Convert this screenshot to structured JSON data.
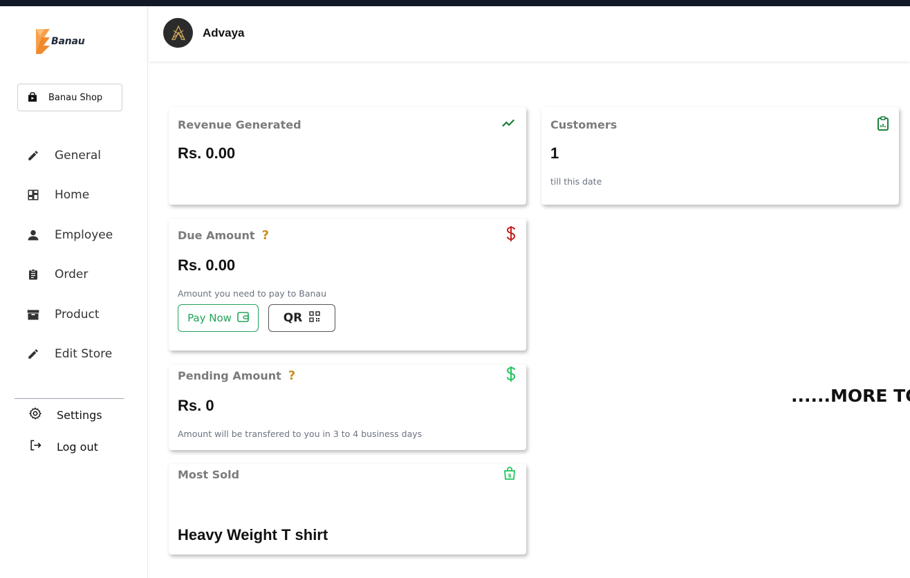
{
  "brand": {
    "name": "Banau"
  },
  "shop_button": {
    "label": "Banau Shop"
  },
  "nav": {
    "items": [
      {
        "label": "General",
        "icon": "pencil-icon"
      },
      {
        "label": "Home",
        "icon": "dashboard-icon"
      },
      {
        "label": "Employee",
        "icon": "person-icon"
      },
      {
        "label": "Order",
        "icon": "clipboard-icon"
      },
      {
        "label": "Product",
        "icon": "box-icon"
      },
      {
        "label": "Edit Store",
        "icon": "pencil-icon"
      }
    ]
  },
  "footer_nav": {
    "settings": "Settings",
    "logout": "Log out"
  },
  "header": {
    "store_name": "Advaya"
  },
  "cards": {
    "revenue": {
      "title": "Revenue Generated",
      "value": "Rs. 0.00",
      "icon": "trending-up-icon",
      "icon_color": "#1a7f3c"
    },
    "customers": {
      "title": "Customers",
      "value": "1",
      "subtitle": "till this date",
      "icon": "clipboard-chart-icon",
      "icon_color": "#1a7f3c"
    },
    "due": {
      "title": "Due Amount",
      "help": "?",
      "value": "Rs. 0.00",
      "subtitle": "Amount you need to pay to Banau",
      "pay_label": "Pay Now",
      "qr_label": "QR",
      "icon": "dollar-icon",
      "icon_color": "#c81e1e"
    },
    "pending": {
      "title": "Pending Amount",
      "help": "?",
      "value": "Rs. 0",
      "subtitle": "Amount will be transfered to you in 3 to 4 business days",
      "icon": "dollar-icon",
      "icon_color": "#22c55e"
    },
    "most_sold": {
      "title": "Most Sold",
      "value": "Heavy Weight T shirt",
      "icon": "shopping-bag-icon",
      "icon_color": "#22c55e"
    }
  },
  "more_text": "......MORE TO"
}
